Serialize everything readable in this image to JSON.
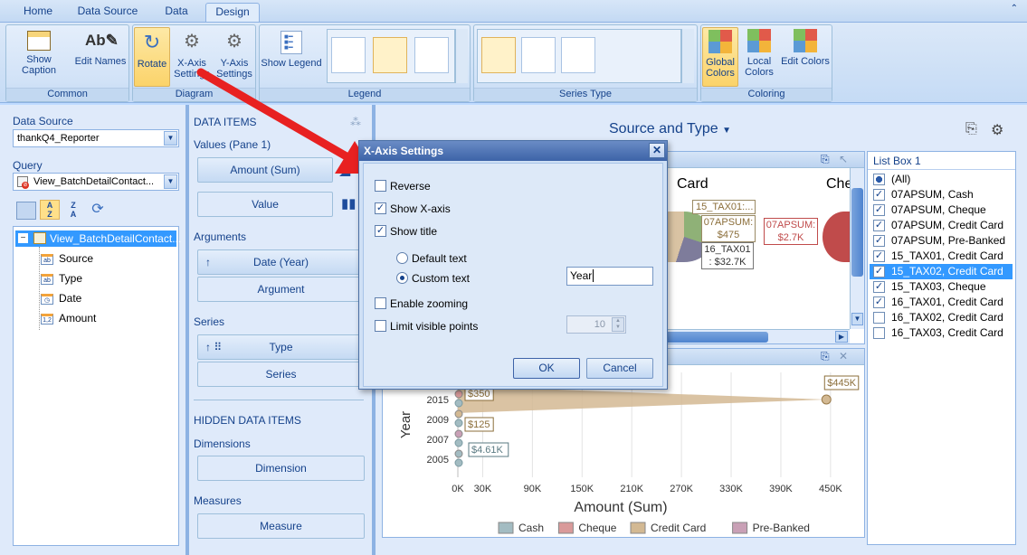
{
  "tabs": [
    "Home",
    "Data Source",
    "Data",
    "Design"
  ],
  "ribbon": {
    "groups": {
      "common": "Common",
      "diagram": "Diagram",
      "legend": "Legend",
      "series_type": "Series Type",
      "coloring": "Coloring"
    },
    "buttons": {
      "show_caption": "Show Caption",
      "edit_names": "Edit Names",
      "rotate": "Rotate",
      "x_axis_settings": "X-Axis Settings",
      "y_axis_settings": "Y-Axis Settings",
      "show_legend": "Show Legend",
      "global_colors": "Global Colors",
      "local_colors": "Local Colors",
      "edit_colors": "Edit Colors"
    }
  },
  "left_panel": {
    "data_source_label": "Data Source",
    "data_source_value": "thankQ4_Reporter",
    "query_label": "Query",
    "query_value": "View_BatchDetailContact...",
    "tree": {
      "root": "View_BatchDetailContact...",
      "fields": [
        {
          "name": "Source",
          "icon": "ab"
        },
        {
          "name": "Type",
          "icon": "ab"
        },
        {
          "name": "Date",
          "icon": "clock"
        },
        {
          "name": "Amount",
          "icon": "1,2"
        }
      ]
    }
  },
  "data_items": {
    "title": "DATA ITEMS",
    "values_label": "Values (Pane 1)",
    "values": [
      "Amount (Sum)",
      "Value"
    ],
    "arguments_label": "Arguments",
    "arguments": [
      "Date (Year)",
      "Argument"
    ],
    "series_label": "Series",
    "series": [
      "Type",
      "Series"
    ],
    "hidden_title": "HIDDEN DATA ITEMS",
    "dimensions_label": "Dimensions",
    "dimensions_btn": "Dimension",
    "measures_label": "Measures",
    "measures_btn": "Measure"
  },
  "dashboard": {
    "title": "Source and Type",
    "pie": {
      "card_label_1": "Card",
      "card_label_2": "Che",
      "labels": [
        "15_TAX01:...",
        "07APSUM: $475",
        "16_TAX01 : $32.7K",
        "07APSUM: $2.7K"
      ]
    },
    "listbox": {
      "title": "List Box 1",
      "items": [
        {
          "label": "(All)",
          "state": "partial"
        },
        {
          "label": "07APSUM, Cash",
          "state": "checked"
        },
        {
          "label": "07APSUM, Cheque",
          "state": "checked"
        },
        {
          "label": "07APSUM, Credit Card",
          "state": "checked"
        },
        {
          "label": "07APSUM, Pre-Banked",
          "state": "checked"
        },
        {
          "label": "15_TAX01, Credit Card",
          "state": "checked"
        },
        {
          "label": "15_TAX02, Credit Card",
          "state": "checked",
          "selected": true
        },
        {
          "label": "15_TAX03, Cheque",
          "state": "checked"
        },
        {
          "label": "16_TAX01, Credit Card",
          "state": "checked"
        },
        {
          "label": "16_TAX02, Credit Card",
          "state": "unchecked"
        },
        {
          "label": "16_TAX03, Credit Card",
          "state": "unchecked"
        }
      ]
    }
  },
  "chart_data": {
    "type": "area",
    "orientation": "horizontal",
    "xlabel": "Amount (Sum)",
    "ylabel": "Year",
    "x_ticks": [
      "0K",
      "30K",
      "90K",
      "150K",
      "210K",
      "270K",
      "330K",
      "390K",
      "450K"
    ],
    "x_tick_values": [
      0,
      30,
      90,
      150,
      210,
      270,
      330,
      390,
      450
    ],
    "y_ticks": [
      "2015",
      "2009",
      "2007",
      "2005"
    ],
    "xlim": [
      0,
      460
    ],
    "series": [
      {
        "name": "Cash",
        "color": "#a3bcc2"
      },
      {
        "name": "Cheque",
        "color": "#d99a9a"
      },
      {
        "name": "Credit Card",
        "color": "#d3b993"
      },
      {
        "name": "Pre-Banked",
        "color": "#c9a0b6"
      }
    ],
    "data_labels": [
      {
        "text": "$445K",
        "x": 445,
        "year": "2015"
      },
      {
        "text": "$350",
        "x": 0.35,
        "year": "2015"
      },
      {
        "text": "$125",
        "x": 0.125,
        "year": "2009"
      },
      {
        "text": "$4.61K",
        "x": 4.61,
        "year": "2007"
      }
    ]
  },
  "dialog": {
    "title": "X-Axis Settings",
    "reverse": "Reverse",
    "show_x_axis": "Show X-axis",
    "show_title": "Show title",
    "default_text": "Default text",
    "custom_text": "Custom text",
    "custom_text_value": "Year",
    "enable_zooming": "Enable zooming",
    "limit_visible_points": "Limit visible points",
    "limit_value": "10",
    "ok": "OK",
    "cancel": "Cancel"
  }
}
